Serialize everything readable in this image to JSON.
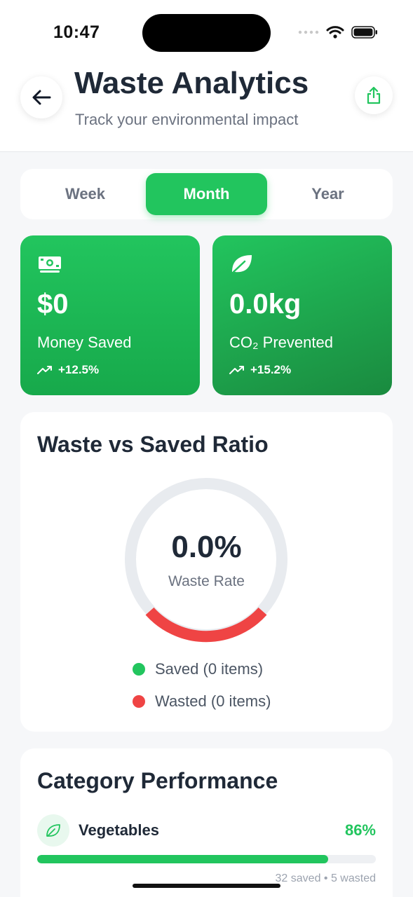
{
  "status_bar": {
    "time": "10:47"
  },
  "header": {
    "title": "Waste Analytics",
    "subtitle": "Track your environmental impact",
    "back_icon": "arrow-left-icon",
    "share_icon": "share-icon"
  },
  "period_tabs": {
    "items": [
      "Week",
      "Month",
      "Year"
    ],
    "selected": "Month"
  },
  "stats": {
    "money": {
      "icon": "money-icon",
      "value": "$0",
      "label": "Money Saved",
      "trend": "+12.5%"
    },
    "co2": {
      "icon": "leaf-icon",
      "value": "0.0kg",
      "label": "CO₂ Prevented",
      "trend": "+15.2%"
    }
  },
  "ratio": {
    "title": "Waste vs Saved Ratio",
    "value": "0.0%",
    "label": "Waste Rate",
    "legend": [
      {
        "label": "Saved (0 items)",
        "color": "#22c55e"
      },
      {
        "label": "Wasted (0 items)",
        "color": "#ef4444"
      }
    ]
  },
  "categories": {
    "title": "Category Performance",
    "items": [
      {
        "icon": "leaf-icon",
        "name": "Vegetables",
        "percent": "86%",
        "fill": 0.86,
        "meta": "32 saved • 5 wasted"
      }
    ]
  },
  "colors": {
    "accent": "#22c55e",
    "danger": "#ef4444",
    "text": "#1f2937",
    "muted": "#6b7280"
  }
}
